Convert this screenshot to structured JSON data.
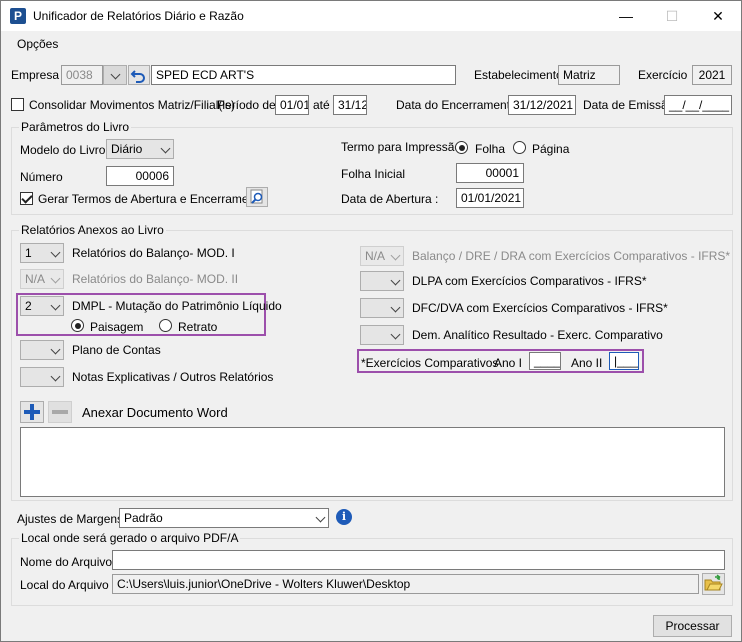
{
  "window": {
    "title": "Unificador de Relatórios Diário e Razão",
    "icon_letter": "P",
    "minimize": "—",
    "maximize": "☐",
    "close": "✕"
  },
  "menu": {
    "opcoes": "Opções"
  },
  "top": {
    "empresa_label": "Empresa",
    "empresa_code": "0038",
    "empresa_name": "SPED ECD ART'S",
    "estabelecimento_label": "Estabelecimento",
    "estabelecimento_value": "Matriz",
    "exercicio_label": "Exercício",
    "exercicio_value": "2021",
    "consolidar_label": "Consolidar Movimentos Matriz/Filial(is)",
    "consolidar_checked": false,
    "periodo_label": "Período de",
    "periodo_de": "01/01",
    "ate_label": "até",
    "periodo_ate": "31/12",
    "encerramento_label": "Data do Encerramento",
    "encerramento_value": "31/12/2021",
    "emissao_label": "Data de Emissão",
    "emissao_value": "__/__/____"
  },
  "parametros": {
    "title": "Parâmetros do Livro",
    "modelo_label": "Modelo do Livro",
    "modelo_value": "Diário",
    "numero_label": "Número",
    "numero_value": "00006",
    "gerar_termos_label": "Gerar Termos de Abertura e Encerramento",
    "gerar_termos_checked": true,
    "termo_label": "Termo para Impressão",
    "folha_option": "Folha",
    "pagina_option": "Página",
    "termo_selected": "Folha",
    "folha_inicial_label": "Folha Inicial",
    "folha_inicial_value": "00001",
    "data_abertura_label": "Data de Abertura :",
    "data_abertura_value": "01/01/2021"
  },
  "relatorios": {
    "title": "Relatórios Anexos ao Livro",
    "balanco_value": "1",
    "balanco_label": "Relatórios do Balanço- MOD. I",
    "balanco2_value": "N/A",
    "balanco2_label": "Relatórios do Balanço- MOD. II",
    "dmpl_value": "2",
    "dmpl_label": "DMPL - Mutação do Patrimônio Líquido",
    "paisagem_option": "Paisagem",
    "retrato_option": "Retrato",
    "orientacao_selected": "Paisagem",
    "plano_value": "",
    "plano_label": "Plano de Contas",
    "notas_value": "",
    "notas_label": "Notas Explicativas / Outros Relatórios",
    "ifrs_value": "N/A",
    "ifrs_label": "Balanço / DRE / DRA com Exercícios Comparativos - IFRS*",
    "dlpa_value": "",
    "dlpa_label": "DLPA com Exercícios Comparativos - IFRS*",
    "dfc_value": "",
    "dfc_label": "DFC/DVA com Exercícios Comparativos - IFRS*",
    "dem_value": "",
    "dem_label": "Dem. Analítico Resultado - Exerc. Comparativo",
    "exercicios_label": "*Exercícios Comparativos",
    "ano1_label": "Ano I",
    "ano1_value": "____",
    "ano2_label": "Ano II",
    "ano2_value": "|____",
    "anexar_label": "Anexar Documento Word"
  },
  "margens": {
    "label": "Ajustes de Margens",
    "value": "Padrão",
    "info_icon": "i"
  },
  "local": {
    "title": "Local onde será gerado o arquivo PDF/A",
    "nome_label": "Nome do Arquivo",
    "nome_value": "",
    "local_label": "Local do Arquivo",
    "local_value": "C:\\Users\\luis.junior\\OneDrive - Wolters Kluwer\\Desktop"
  },
  "processar_label": "Processar",
  "colors": {
    "highlight": "#9c4fab",
    "accent_blue": "#1e5bb8"
  }
}
